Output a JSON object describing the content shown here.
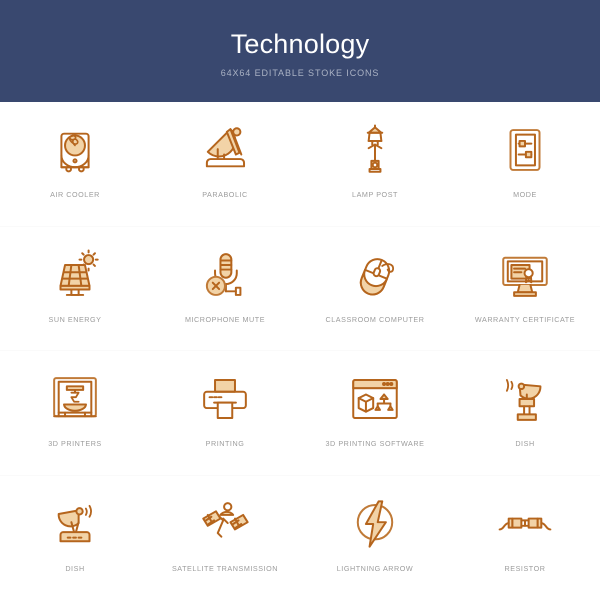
{
  "header": {
    "title": "Technology",
    "subtitle": "64x64 editable stoke icons",
    "background_color": "#39486f",
    "title_color": "#ffffff",
    "subtitle_color": "#aab2c4"
  },
  "palette": {
    "stroke": "#b5651d",
    "stroke_light": "#c07a37",
    "fill": "#f2d3a7",
    "fill_dark": "#eec490",
    "label_color": "#9c9c9c",
    "page_background": "#ffffff"
  },
  "grid": {
    "columns": 4,
    "rows": 4,
    "icon_size": "64x64"
  },
  "icons": [
    {
      "id": "air-cooler",
      "label": "air cooler"
    },
    {
      "id": "parabolic",
      "label": "parabolic"
    },
    {
      "id": "lamp-post",
      "label": "lamp post"
    },
    {
      "id": "mode",
      "label": "mode"
    },
    {
      "id": "sun-energy",
      "label": "sun energy"
    },
    {
      "id": "microphone-mute",
      "label": "microphone mute"
    },
    {
      "id": "classroom-computer",
      "label": "classroom computer"
    },
    {
      "id": "warranty-certificate",
      "label": "warranty certificate"
    },
    {
      "id": "3d-printers",
      "label": "3d printers"
    },
    {
      "id": "printing",
      "label": "printing"
    },
    {
      "id": "3d-printing-software",
      "label": "3d printing software"
    },
    {
      "id": "dish",
      "label": "dish"
    },
    {
      "id": "dish-2",
      "label": "dish"
    },
    {
      "id": "satellite-transmission",
      "label": "satellite transmission"
    },
    {
      "id": "lightning-arrow",
      "label": "lightning arrow"
    },
    {
      "id": "resistor",
      "label": "resistor"
    }
  ]
}
